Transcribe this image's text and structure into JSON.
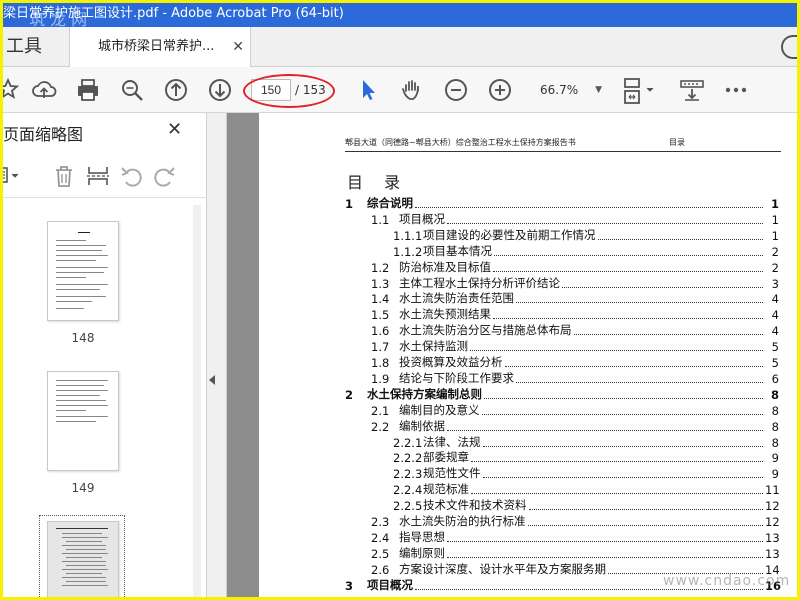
{
  "titlebar": {
    "title": "梁日常养护施工图设计.pdf - Adobe Acrobat Pro (64-bit)",
    "watermark": "筑 龙 网"
  },
  "tabs": {
    "tools_label": "工具",
    "document_label": "城市桥梁日常养护...",
    "close_label": "✕"
  },
  "toolbar": {
    "current_page": "150",
    "total_pages": "/ 153",
    "zoom": "66.7%"
  },
  "sidebar": {
    "title": "页面缩略图",
    "close_label": "✕",
    "thumbnails": [
      {
        "label": "148"
      },
      {
        "label": "149"
      }
    ]
  },
  "page": {
    "running_head_left": "郫县大道（同德路~郫县大桥）综合整治工程水土保持方案报告书",
    "running_head_right": "目录",
    "toc_title": "目 录",
    "toc": [
      {
        "level": 1,
        "num": "1",
        "text": "综合说明",
        "page": "1"
      },
      {
        "level": 2,
        "num": "1.1",
        "text": "项目概况",
        "page": "1"
      },
      {
        "level": 3,
        "num": "1.1.1",
        "text": "项目建设的必要性及前期工作情况",
        "page": "1"
      },
      {
        "level": 3,
        "num": "1.1.2",
        "text": "项目基本情况",
        "page": "2"
      },
      {
        "level": 2,
        "num": "1.2",
        "text": "防治标准及目标值",
        "page": "2"
      },
      {
        "level": 2,
        "num": "1.3",
        "text": "主体工程水土保持分析评价结论",
        "page": "3"
      },
      {
        "level": 2,
        "num": "1.4",
        "text": "水土流失防治责任范围",
        "page": "4"
      },
      {
        "level": 2,
        "num": "1.5",
        "text": "水土流失预测结果",
        "page": "4"
      },
      {
        "level": 2,
        "num": "1.6",
        "text": "水土流失防治分区与措施总体布局",
        "page": "4"
      },
      {
        "level": 2,
        "num": "1.7",
        "text": "水土保持监测",
        "page": "5"
      },
      {
        "level": 2,
        "num": "1.8",
        "text": "投资概算及效益分析",
        "page": "5"
      },
      {
        "level": 2,
        "num": "1.9",
        "text": "结论与下阶段工作要求",
        "page": "6"
      },
      {
        "level": 1,
        "num": "2",
        "text": "水土保持方案编制总则",
        "page": "8"
      },
      {
        "level": 2,
        "num": "2.1",
        "text": "编制目的及意义",
        "page": "8"
      },
      {
        "level": 2,
        "num": "2.2",
        "text": "编制依据",
        "page": "8"
      },
      {
        "level": 3,
        "num": "2.2.1",
        "text": "法律、法规",
        "page": "8"
      },
      {
        "level": 3,
        "num": "2.2.2",
        "text": "部委规章",
        "page": "9"
      },
      {
        "level": 3,
        "num": "2.2.3",
        "text": "规范性文件",
        "page": "9"
      },
      {
        "level": 3,
        "num": "2.2.4",
        "text": "规范标准",
        "page": "11"
      },
      {
        "level": 3,
        "num": "2.2.5",
        "text": "技术文件和技术资料",
        "page": "12"
      },
      {
        "level": 2,
        "num": "2.3",
        "text": "水土流失防治的执行标准",
        "page": "12"
      },
      {
        "level": 2,
        "num": "2.4",
        "text": "指导思想",
        "page": "13"
      },
      {
        "level": 2,
        "num": "2.5",
        "text": "编制原则",
        "page": "13"
      },
      {
        "level": 2,
        "num": "2.6",
        "text": "方案设计深度、设计水平年及方案服务期",
        "page": "14"
      },
      {
        "level": 1,
        "num": "3",
        "text": "项目概况",
        "page": "16"
      }
    ]
  },
  "watermark_br": "www.cndao.com",
  "colors": {
    "titlebar": "#2b6ad8",
    "highlight_border": "#f3f300",
    "annotation_ellipse": "#e0242a",
    "select_arrow": "#2b6ad8"
  }
}
